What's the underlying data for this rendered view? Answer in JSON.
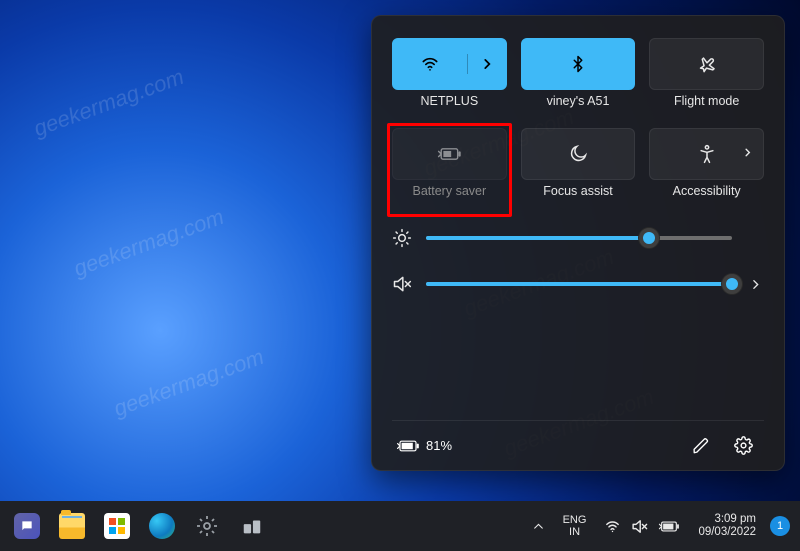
{
  "watermark": "geekermag.com",
  "panel": {
    "tiles": [
      {
        "key": "wifi",
        "label": "NETPLUS",
        "on": true,
        "split": true
      },
      {
        "key": "bluetooth",
        "label": "viney's A51",
        "on": true,
        "split": false
      },
      {
        "key": "flight",
        "label": "Flight mode",
        "on": false,
        "split": false
      },
      {
        "key": "battery_saver",
        "label": "Battery saver",
        "on": false,
        "dim": true,
        "highlighted": true
      },
      {
        "key": "focus",
        "label": "Focus assist",
        "on": false
      },
      {
        "key": "accessibility",
        "label": "Accessibility",
        "on": false,
        "chevron": true
      }
    ],
    "sliders": {
      "brightness": {
        "percent": 73
      },
      "volume": {
        "percent": 100,
        "muted": true
      }
    },
    "footer": {
      "battery_text": "81%"
    }
  },
  "taskbar": {
    "language": {
      "line1": "ENG",
      "line2": "IN"
    },
    "clock": {
      "time": "3:09 pm",
      "date": "09/03/2022"
    },
    "notification_count": "1"
  }
}
